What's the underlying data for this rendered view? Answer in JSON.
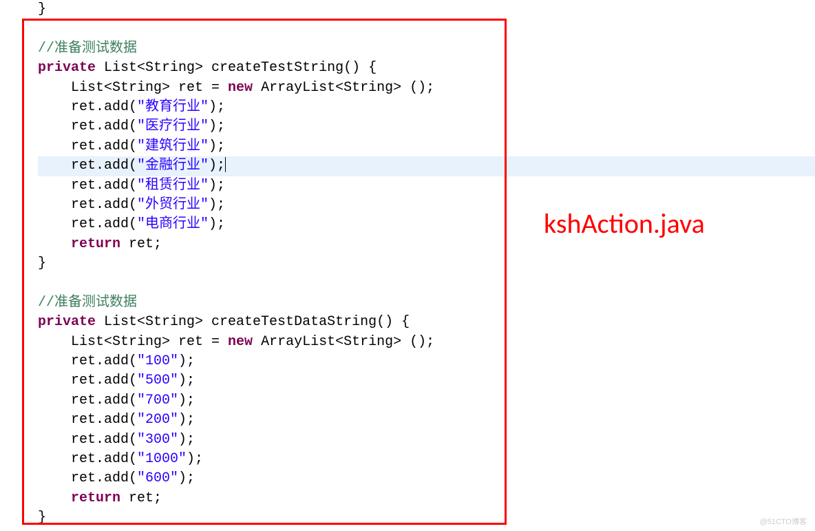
{
  "filename": "kshAction.java",
  "watermark": "@51CTO博客",
  "code": {
    "brace_close_top": "}",
    "comment1": "//准备测试数据",
    "m1_sig_kw1": "private",
    "m1_sig_mid": " List<String> createTestString() {",
    "m1_local_pre": "    List<String> ret = ",
    "m1_local_kw": "new",
    "m1_local_post": " ArrayList<String> ();",
    "m1_add_pre": "    ret.add(",
    "m1_add_post": ");",
    "m1_v1": "\"教育行业\"",
    "m1_v2": "\"医疗行业\"",
    "m1_v3": "\"建筑行业\"",
    "m1_v4": "\"金融行业\"",
    "m1_v5": "\"租赁行业\"",
    "m1_v6": "\"外贸行业\"",
    "m1_v7": "\"电商行业\"",
    "ret_kw": "return",
    "ret_post": " ret;",
    "brace_close": "}",
    "comment2": "//准备测试数据",
    "m2_sig_kw1": "private",
    "m2_sig_mid": " List<String> createTestDataString() {",
    "m2_local_pre": "    List<String> ret = ",
    "m2_local_kw": "new",
    "m2_local_post": " ArrayList<String> ();",
    "m2_v1": "\"100\"",
    "m2_v2": "\"500\"",
    "m2_v3": "\"700\"",
    "m2_v4": "\"200\"",
    "m2_v5": "\"300\"",
    "m2_v6": "\"1000\"",
    "m2_v7": "\"600\""
  }
}
